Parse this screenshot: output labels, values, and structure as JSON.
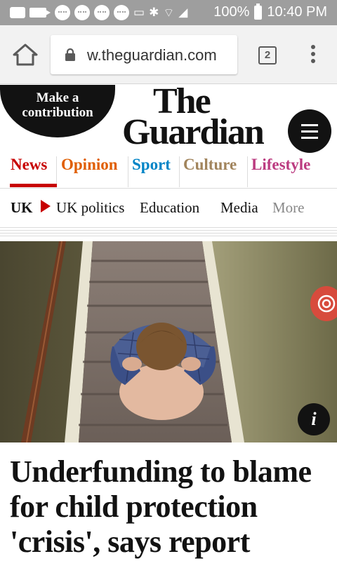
{
  "status_bar": {
    "battery_percent": "100%",
    "time": "10:40 PM",
    "icons": [
      "message-icon",
      "video-icon",
      "chat-icon",
      "chat-icon",
      "chat-icon",
      "chat-icon",
      "cast-icon",
      "bluetooth-icon",
      "wifi-icon",
      "signal-icon",
      "battery-icon"
    ]
  },
  "browser": {
    "url": "w.theguardian.com",
    "tab_count": "2",
    "icons": [
      "home-icon",
      "lock-icon",
      "more-vert-icon"
    ]
  },
  "header": {
    "contribute_line1": "Make a",
    "contribute_line2": "contribution",
    "logo_line1": "The",
    "logo_line2": "Guardian",
    "menu_icon": "hamburger-icon"
  },
  "pillars": [
    {
      "label": "News",
      "color": "#c70000"
    },
    {
      "label": "Opinion",
      "color": "#e05e00"
    },
    {
      "label": "Sport",
      "color": "#0084c6"
    },
    {
      "label": "Culture",
      "color": "#a1845c"
    },
    {
      "label": "Lifestyle",
      "color": "#bb3b80"
    }
  ],
  "subnav": {
    "items": [
      "UK",
      "UK politics",
      "Education",
      "Media",
      "More"
    ],
    "active": "UK"
  },
  "article": {
    "info_label": "i",
    "headline": "Underfunding to blame for child protection 'crisis', says report"
  }
}
